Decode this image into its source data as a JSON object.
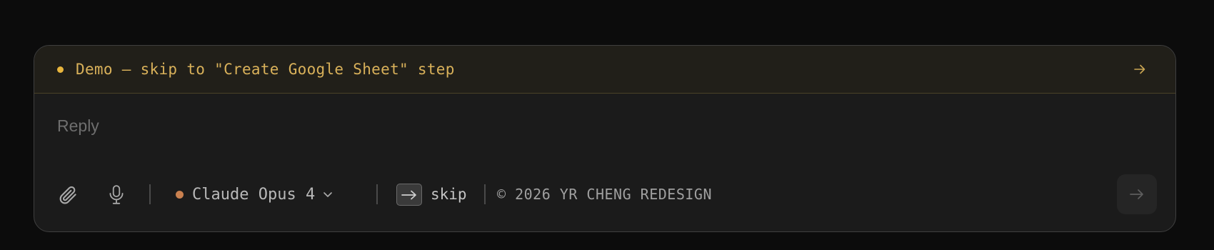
{
  "banner": {
    "text": "Demo — skip to \"Create Google Sheet\" step",
    "dot_color": "#e8b53d",
    "icon": "arrow-right-icon"
  },
  "composer": {
    "placeholder": "Reply",
    "value": ""
  },
  "toolbar": {
    "attach_icon": "paperclip-icon",
    "mic_icon": "microphone-icon",
    "model": {
      "label": "Claude Opus 4",
      "dot_color": "#c9804f",
      "icon": "chevron-down-icon"
    },
    "skip": {
      "key_icon": "arrow-right-icon",
      "label": "skip"
    },
    "copyright": "© 2026 YR CHENG REDESIGN",
    "send_icon": "arrow-right-icon"
  }
}
